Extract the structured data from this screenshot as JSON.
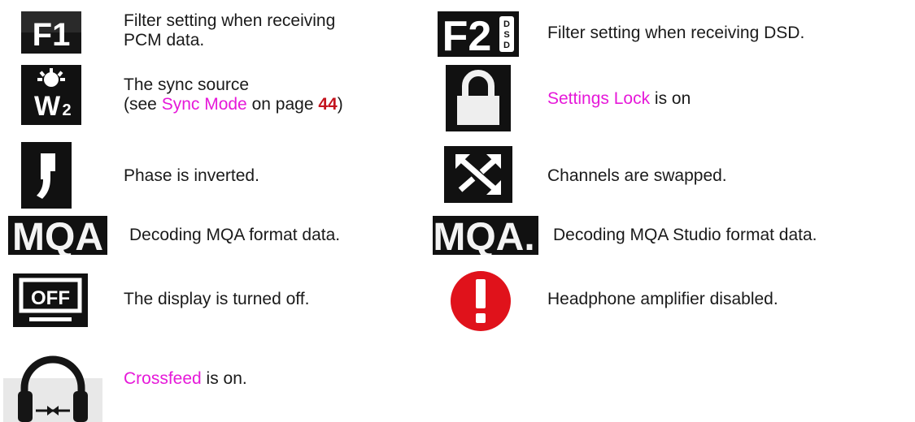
{
  "entries": {
    "f1": {
      "icon_name": "f1-filter-icon",
      "icon_text": "F1",
      "line1": "Filter setting when receiving",
      "line2": "PCM data."
    },
    "f2": {
      "icon_name": "f2-dsd-filter-icon",
      "icon_text": "F2",
      "icon_sub": "DSD",
      "text": "Filter setting when receiving DSD."
    },
    "sync": {
      "icon_name": "sync-source-icon",
      "line1": "The sync source",
      "line2_pre": "(see ",
      "link": "Sync Mode",
      "line2_mid": " on page ",
      "page": "44",
      "line2_post": ")"
    },
    "lock": {
      "icon_name": "lock-icon",
      "link": "Settings Lock",
      "text": " is on"
    },
    "phase": {
      "icon_name": "phase-inverted-icon",
      "text": "Phase is inverted."
    },
    "swap": {
      "icon_name": "channel-swap-icon",
      "text": "Channels are swapped."
    },
    "mqa": {
      "icon_name": "mqa-icon",
      "icon_text": "MQA",
      "text": "Decoding MQA format data."
    },
    "mqa_studio": {
      "icon_name": "mqa-studio-icon",
      "icon_text": "MQA.",
      "text": "Decoding MQA Studio format data."
    },
    "display_off": {
      "icon_name": "display-off-icon",
      "icon_text": "OFF",
      "text": "The display is turned off."
    },
    "hp_disabled": {
      "icon_name": "warning-icon",
      "text": "Headphone amplifier disabled."
    },
    "crossfeed": {
      "icon_name": "crossfeed-headphone-icon",
      "link": "Crossfeed",
      "text": " is on."
    }
  },
  "colors": {
    "link": "#e619d9",
    "page_ref": "#c4141e",
    "warning": "#e0121b"
  }
}
